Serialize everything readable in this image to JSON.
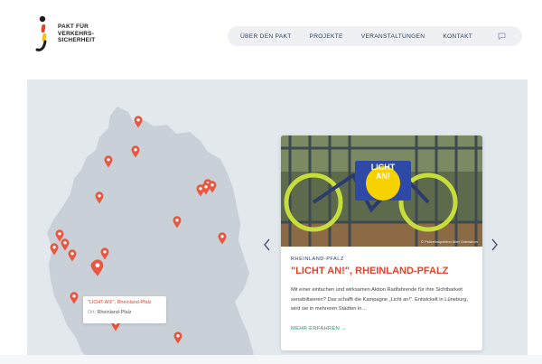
{
  "header": {
    "logo_lines": [
      "PAKT FÜR",
      "VERKEHRS-",
      "SICHERHEIT"
    ],
    "nav": [
      {
        "label": "ÜBER DEN PAKT"
      },
      {
        "label": "PROJEKTE"
      },
      {
        "label": "VERANSTALTUNGEN"
      },
      {
        "label": "KONTAKT"
      }
    ],
    "nav_icon": "speech-bubble-icon"
  },
  "map": {
    "marker_icon": "map-pin-icon",
    "marker_color": "#e8573f",
    "tooltip": {
      "title": "\"LICHT AN!\", Rheinland-Pfalz",
      "label": "Ort:",
      "place": "Rheinland-Pfalz"
    }
  },
  "card": {
    "photo_sign": "LICHT AN!",
    "photo_caption": "© Polizeiinspektion Alter Oderstrom",
    "category": "RHEINLAND-PFALZ",
    "title": "\"LICHT AN!\", RHEINLAND-PFALZ",
    "text": "Mit einer einfachen und wirksamen Aktion Radfahrende für ihre Sichtbarkeit sensibilisieren? Das schafft die Kampagne „Licht an!“. Entwickelt in Lüneburg, wird sie in mehreren Städten in…",
    "link": "MEHR ERFAHREN →"
  },
  "colors": {
    "accent": "#e0442b",
    "navy": "#2c3e6b",
    "link": "#2f8f73",
    "map_land": "#c9d0d8",
    "background": "#e3e8ed"
  }
}
